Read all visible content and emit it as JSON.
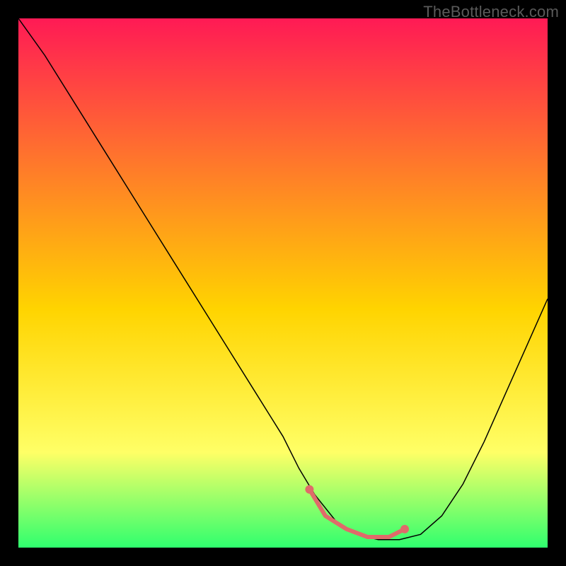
{
  "watermark": "TheBottleneck.com",
  "chart_data": {
    "type": "line",
    "title": "",
    "xlabel": "",
    "ylabel": "",
    "xlim": [
      0,
      100
    ],
    "ylim": [
      0,
      100
    ],
    "grid": false,
    "background_gradient": {
      "top": "#ff1a55",
      "mid_upper": "#ff7a2a",
      "mid": "#ffd400",
      "mid_lower": "#ffff66",
      "bottom": "#2fff6e"
    },
    "series": [
      {
        "name": "curve",
        "color": "#000000",
        "stroke_width": 1.5,
        "x": [
          0,
          5,
          10,
          15,
          20,
          25,
          30,
          35,
          40,
          45,
          50,
          53,
          56,
          60,
          64,
          68,
          72,
          76,
          80,
          84,
          88,
          92,
          96,
          100
        ],
        "y": [
          100,
          93,
          85,
          77,
          69,
          61,
          53,
          45,
          37,
          29,
          21,
          15,
          10,
          5,
          2.5,
          1.5,
          1.5,
          2.5,
          6,
          12,
          20,
          29,
          38,
          47
        ]
      },
      {
        "name": "highlight",
        "color": "#e06a6a",
        "stroke_width": 6,
        "x": [
          55,
          58,
          62,
          66,
          70,
          73
        ],
        "y": [
          11,
          6,
          3.5,
          2,
          2,
          3.5
        ]
      },
      {
        "name": "highlight-dot-left",
        "color": "#e06a6a",
        "marker": "circle",
        "radius": 6,
        "x": [
          55
        ],
        "y": [
          11
        ]
      },
      {
        "name": "highlight-dot-right",
        "color": "#e06a6a",
        "marker": "circle",
        "radius": 6,
        "x": [
          73
        ],
        "y": [
          3.5
        ]
      }
    ]
  }
}
